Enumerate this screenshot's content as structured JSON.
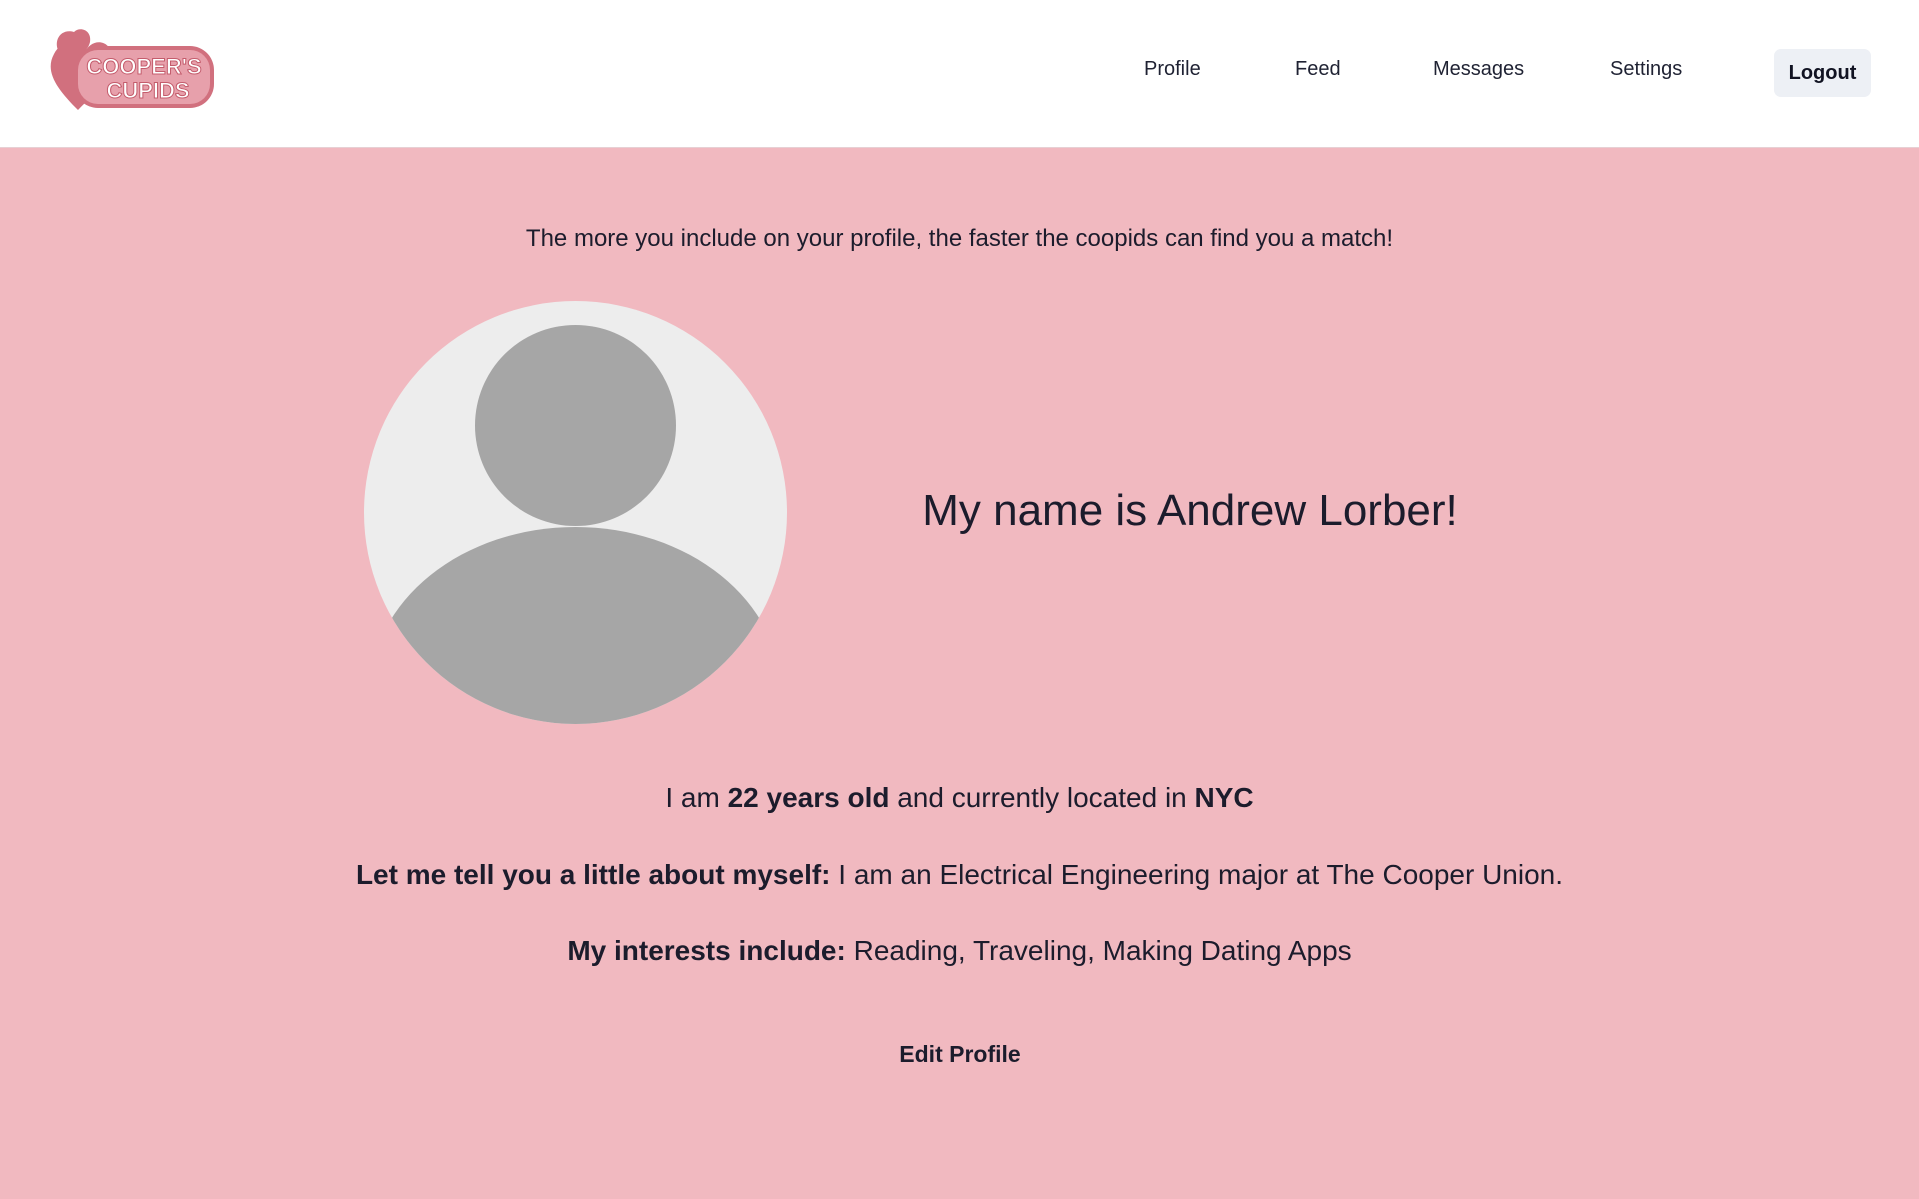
{
  "brand": {
    "logo_line1": "COOPER'S",
    "logo_line2": "CUPIDS",
    "logo_icon": "hearts-logo-icon"
  },
  "nav": {
    "items": [
      {
        "label": "Profile"
      },
      {
        "label": "Feed"
      },
      {
        "label": "Messages"
      },
      {
        "label": "Settings"
      }
    ],
    "logout_label": "Logout"
  },
  "profile": {
    "tagline": "The more you include on your profile, the faster the coopids can find you a match!",
    "avatar_icon": "default-avatar-icon",
    "name_heading": "My name is Andrew Lorber!",
    "age_prefix": "I am",
    "age": "22 years old",
    "location_prefix": "and currently located in",
    "location": "NYC",
    "about_label": "Let me tell you a little about myself:",
    "about_text": "I am an Electrical Engineering major at The Cooper Union.",
    "interests_label": "My interests include:",
    "interests_text": "Reading, Traveling, Making Dating Apps",
    "edit_label": "Edit Profile"
  },
  "colors": {
    "page_background": "#f1b9c0",
    "navbar_background": "#ffffff",
    "logo_pink": "#d1707e",
    "avatar_background": "#ededed",
    "avatar_silhouette": "#a6a6a6",
    "logout_background": "#edf0f5"
  }
}
